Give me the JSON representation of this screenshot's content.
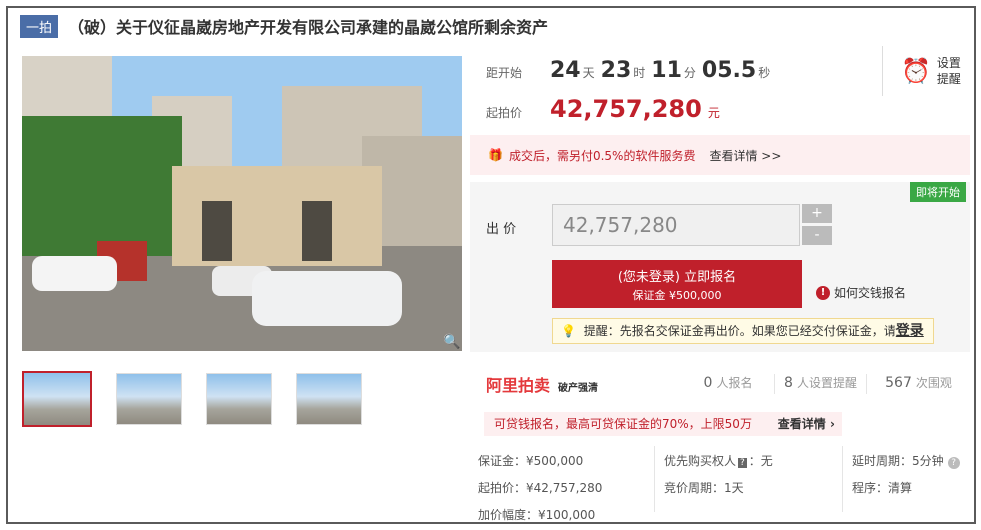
{
  "header": {
    "tag": "一拍",
    "title": "（破）关于仪征晶崴房地产开发有限公司承建的晶崴公馆所剩余资产"
  },
  "countdown": {
    "label": "距开始",
    "days": "24",
    "days_unit": "天",
    "hours": "23",
    "hours_unit": "时",
    "minutes": "11",
    "minutes_unit": "分",
    "seconds": "05.5",
    "seconds_unit": "秒"
  },
  "start_price": {
    "label": "起拍价",
    "value": "42,757,280",
    "unit": "元"
  },
  "remind": {
    "line1": "设置",
    "line2": "提醒"
  },
  "fee_notice": {
    "text": "成交后，需另付0.5%的软件服务费",
    "link": "查看详情 >>"
  },
  "bid": {
    "badge": "即将开始",
    "label": "出 价",
    "value": "42,757,280",
    "plus": "+",
    "minus": "-",
    "signup_line1": "(您未登录) 立即报名",
    "signup_line2": "保证金 ¥500,000",
    "how_text": "如何交钱报名",
    "tip_text": "提醒：先报名交保证金再出价。如果您已经交付保证金，请",
    "tip_login": "登录"
  },
  "platform": {
    "logo": "阿里拍卖",
    "sub": "破产强清"
  },
  "stats": [
    {
      "num": "0",
      "text": "人报名"
    },
    {
      "num": "8",
      "text": "人设置提醒"
    },
    {
      "num": "567",
      "text": "次围观"
    }
  ],
  "loan": {
    "text": "可贷钱报名，最高可贷保证金的70%，上限50万",
    "link": "查看详情 ›"
  },
  "info": {
    "deposit": "保证金：¥500,000",
    "start_price": "起拍价：¥42,757,280",
    "increment": "加价幅度：¥100,000",
    "priority_label": "优先购买权人",
    "priority_badge": "?",
    "priority_value": "：无",
    "bid_period": "竞价周期：1天",
    "delay_period": "延时周期：5分钟",
    "procedure": "程序：清算"
  },
  "colors": {
    "accent": "#c0202b",
    "tag": "#4a6da7",
    "soon": "#3aa845"
  }
}
